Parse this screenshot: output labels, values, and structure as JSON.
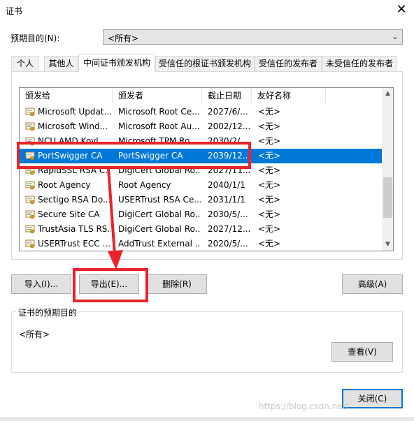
{
  "window": {
    "title": "证书",
    "close_glyph": "✕"
  },
  "purpose": {
    "label": "预期目的(N):",
    "value": "<所有>"
  },
  "tabs": [
    {
      "label": "个人"
    },
    {
      "label": "其他人"
    },
    {
      "label": "中间证书颁发机构"
    },
    {
      "label": "受信任的根证书颁发机构"
    },
    {
      "label": "受信任的发布者"
    },
    {
      "label": "未受信任的发布者"
    }
  ],
  "columns": {
    "issued_to": "颁发给",
    "issued_by": "颁发者",
    "expiry": "截止日期",
    "friendly": "友好名称"
  },
  "rows": [
    {
      "issued_to": "Microsoft Updat...",
      "issued_by": "Microsoft Root Ce...",
      "expiry": "2027/6/...",
      "friendly": "<无>"
    },
    {
      "issued_to": "Microsoft Wind...",
      "issued_by": "Microsoft Root Au...",
      "expiry": "2002/12...",
      "friendly": "<无>"
    },
    {
      "issued_to": "NCU AMD Kovl",
      "issued_by": "Microsoft TPM Ro...",
      "expiry": "2030/2/...",
      "friendly": "<无>"
    },
    {
      "issued_to": "PortSwigger CA",
      "issued_by": "PortSwigger CA",
      "expiry": "2039/12...",
      "friendly": "<无>"
    },
    {
      "issued_to": "RapidSSL RSA C...",
      "issued_by": "DigiCert Global Ro...",
      "expiry": "2027/11...",
      "friendly": "<无>"
    },
    {
      "issued_to": "Root Agency",
      "issued_by": "Root Agency",
      "expiry": "2040/1/1",
      "friendly": "<无>"
    },
    {
      "issued_to": "Sectigo RSA Do...",
      "issued_by": "USERTrust RSA Ce...",
      "expiry": "2031/1/1",
      "friendly": "<无>"
    },
    {
      "issued_to": "Secure Site CA",
      "issued_by": "DigiCert Global Ro...",
      "expiry": "2030/5/...",
      "friendly": "<无>"
    },
    {
      "issued_to": "TrustAsia TLS RS...",
      "issued_by": "DigiCert Global Ro...",
      "expiry": "2027/12...",
      "friendly": "<无>"
    },
    {
      "issued_to": "USERTrust ECC ...",
      "issued_by": "AddTrust External ...",
      "expiry": "2020/5/...",
      "friendly": "<无>"
    }
  ],
  "buttons": {
    "import": "导入(I)...",
    "export": "导出(E)...",
    "remove": "删除(R)",
    "advanced": "高级(A)",
    "view": "查看(V)",
    "close": "关闭(C)"
  },
  "purposes_group": {
    "title": "证书的预期目的",
    "value": "<所有>"
  },
  "watermark": "https://blog.csdn.net/...",
  "colors": {
    "selection": "#0078d7",
    "annotation_red": "#e8232a"
  }
}
